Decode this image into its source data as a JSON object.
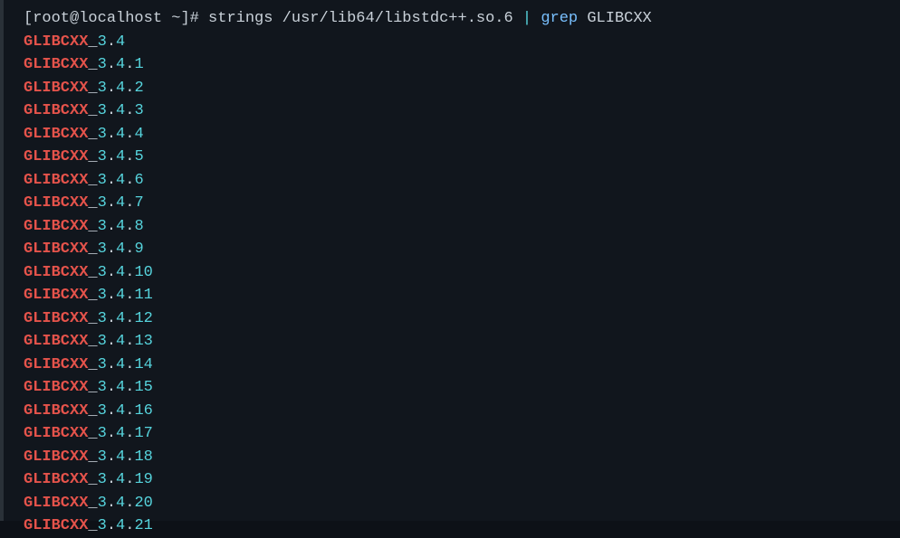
{
  "prompt": {
    "open_bracket": "[",
    "user_host": "root@localhost",
    "space1": " ",
    "tilde": "~",
    "close_bracket": "]",
    "hash": "# ",
    "cmd": "strings ",
    "path": "/usr/lib64/libstdc++.so.6",
    "space2": " ",
    "pipe": "|",
    "space3": " ",
    "grep": "grep",
    "space4": " ",
    "arg": "GLIBCXX"
  },
  "match_text": "GLIBCXX",
  "underscore": "_",
  "lines": [
    {
      "a": "3",
      "b": "4",
      "c": ""
    },
    {
      "a": "3",
      "b": "4",
      "c": "1"
    },
    {
      "a": "3",
      "b": "4",
      "c": "2"
    },
    {
      "a": "3",
      "b": "4",
      "c": "3"
    },
    {
      "a": "3",
      "b": "4",
      "c": "4"
    },
    {
      "a": "3",
      "b": "4",
      "c": "5"
    },
    {
      "a": "3",
      "b": "4",
      "c": "6"
    },
    {
      "a": "3",
      "b": "4",
      "c": "7"
    },
    {
      "a": "3",
      "b": "4",
      "c": "8"
    },
    {
      "a": "3",
      "b": "4",
      "c": "9"
    },
    {
      "a": "3",
      "b": "4",
      "c": "10"
    },
    {
      "a": "3",
      "b": "4",
      "c": "11"
    },
    {
      "a": "3",
      "b": "4",
      "c": "12"
    },
    {
      "a": "3",
      "b": "4",
      "c": "13"
    },
    {
      "a": "3",
      "b": "4",
      "c": "14"
    },
    {
      "a": "3",
      "b": "4",
      "c": "15"
    },
    {
      "a": "3",
      "b": "4",
      "c": "16"
    },
    {
      "a": "3",
      "b": "4",
      "c": "17"
    },
    {
      "a": "3",
      "b": "4",
      "c": "18"
    },
    {
      "a": "3",
      "b": "4",
      "c": "19"
    },
    {
      "a": "3",
      "b": "4",
      "c": "20"
    },
    {
      "a": "3",
      "b": "4",
      "c": "21"
    }
  ]
}
